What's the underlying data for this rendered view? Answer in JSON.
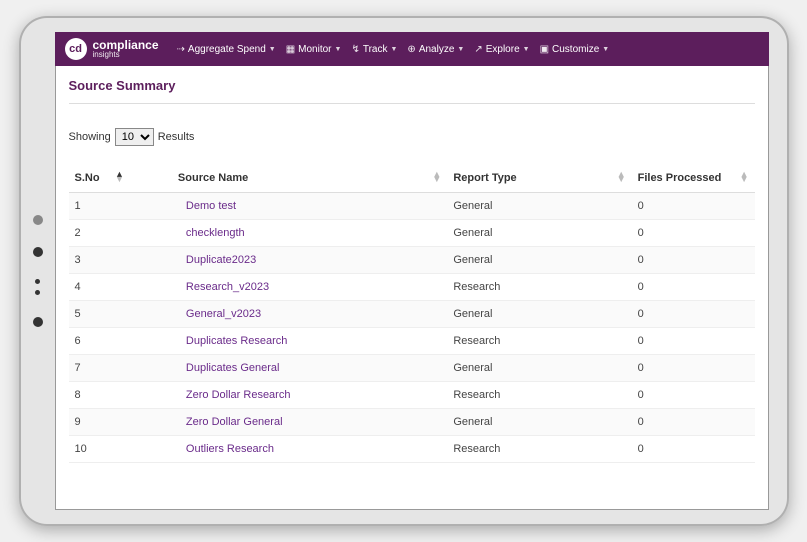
{
  "brand": {
    "badge": "cd",
    "name": "compliance",
    "sub": "insights"
  },
  "nav": {
    "items": [
      {
        "icon": "⇢",
        "label": "Aggregate Spend"
      },
      {
        "icon": "▦",
        "label": "Monitor"
      },
      {
        "icon": "↯",
        "label": "Track"
      },
      {
        "icon": "⊕",
        "label": "Analyze"
      },
      {
        "icon": "↗",
        "label": "Explore"
      },
      {
        "icon": "▣",
        "label": "Customize"
      }
    ]
  },
  "page": {
    "title": "Source Summary",
    "showing_prefix": "Showing",
    "showing_suffix": "Results",
    "rows_select": "10"
  },
  "table": {
    "headers": {
      "sno": "S.No",
      "source": "Source Name",
      "report": "Report Type",
      "files": "Files Processed"
    },
    "rows": [
      {
        "sno": "1",
        "source": "Demo test",
        "report": "General",
        "files": "0"
      },
      {
        "sno": "2",
        "source": "checklength",
        "report": "General",
        "files": "0"
      },
      {
        "sno": "3",
        "source": "Duplicate2023",
        "report": "General",
        "files": "0"
      },
      {
        "sno": "4",
        "source": "Research_v2023",
        "report": "Research",
        "files": "0"
      },
      {
        "sno": "5",
        "source": "General_v2023",
        "report": "General",
        "files": "0"
      },
      {
        "sno": "6",
        "source": "Duplicates Research",
        "report": "Research",
        "files": "0"
      },
      {
        "sno": "7",
        "source": "Duplicates General",
        "report": "General",
        "files": "0"
      },
      {
        "sno": "8",
        "source": "Zero Dollar Research",
        "report": "Research",
        "files": "0"
      },
      {
        "sno": "9",
        "source": "Zero Dollar General",
        "report": "General",
        "files": "0"
      },
      {
        "sno": "10",
        "source": "Outliers Research",
        "report": "Research",
        "files": "0"
      }
    ]
  }
}
